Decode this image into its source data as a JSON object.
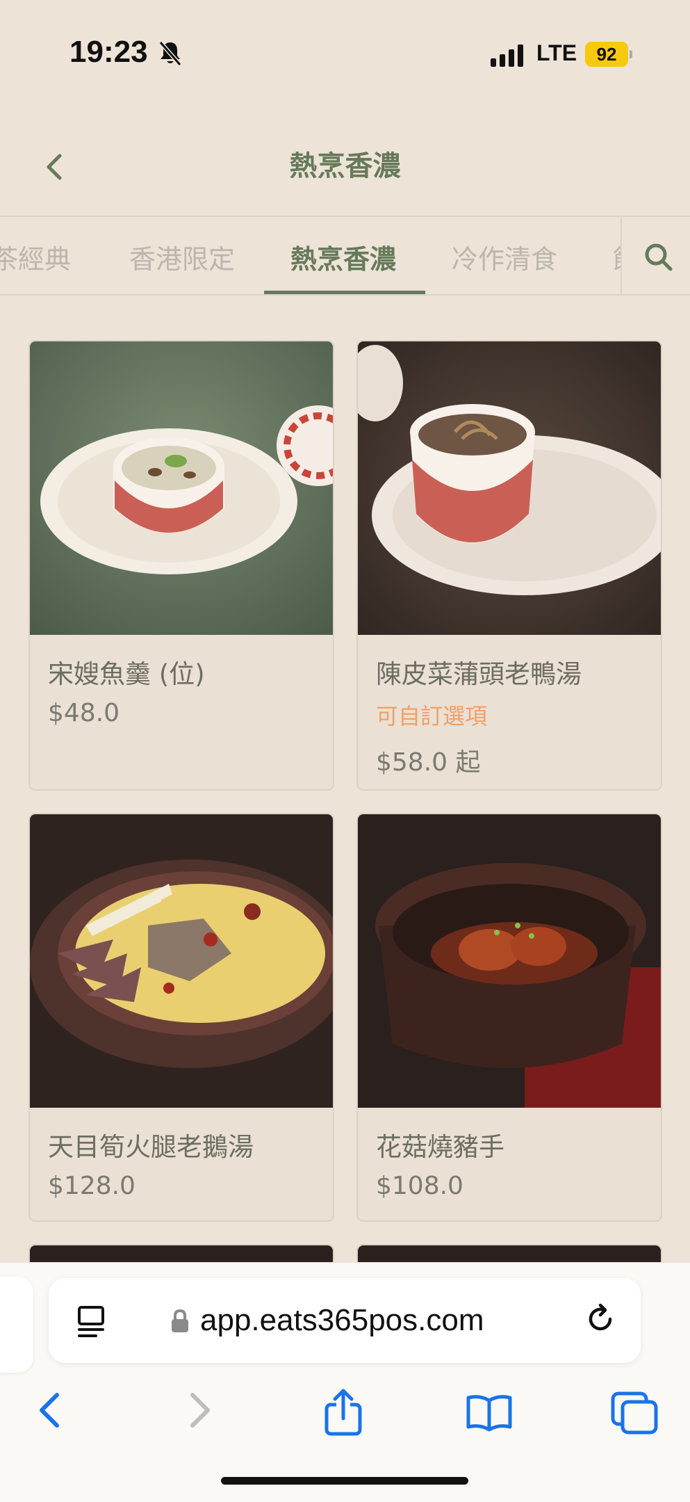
{
  "status": {
    "time": "19:23",
    "network": "LTE",
    "battery": "92"
  },
  "header": {
    "title": "熱烹香濃"
  },
  "tabs": [
    {
      "label": "茶經典",
      "active": false
    },
    {
      "label": "香港限定",
      "active": false
    },
    {
      "label": "熱烹香濃",
      "active": true
    },
    {
      "label": "冷作清食",
      "active": false
    },
    {
      "label": "飯",
      "active": false
    }
  ],
  "menu": {
    "items": [
      {
        "name": "宋嫂魚羹 (位)",
        "price": "$48.0"
      },
      {
        "name": "陳皮菜蒲頭老鴨湯",
        "option": "可自訂選項",
        "price": "$58.0 起"
      },
      {
        "name": "天目筍火腿老鵝湯",
        "price": "$128.0"
      },
      {
        "name": "花菇燒豬手",
        "price": "$108.0"
      }
    ]
  },
  "browser": {
    "url": "app.eats365pos.com"
  },
  "colors": {
    "accent": "#667a5a",
    "background": "#ede3d7",
    "option": "#f0a06a",
    "ios_blue": "#1a73e8"
  }
}
